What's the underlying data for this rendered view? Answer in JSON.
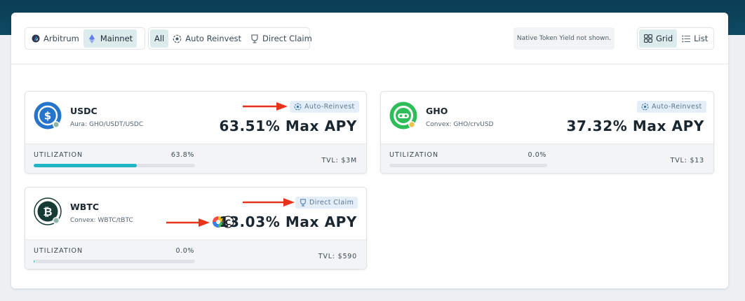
{
  "toolbar": {
    "networks": [
      {
        "label": "Arbitrum",
        "active": false
      },
      {
        "label": "Mainnet",
        "active": true
      }
    ],
    "filters": [
      {
        "label": "All",
        "active": true
      },
      {
        "label": "Auto Reinvest",
        "active": false
      },
      {
        "label": "Direct Claim",
        "active": false
      }
    ],
    "notice": "Native Token Yield not shown.",
    "views": [
      {
        "label": "Grid",
        "active": true
      },
      {
        "label": "List",
        "active": false
      }
    ]
  },
  "pools": [
    {
      "token": "USDC",
      "pool": "Aura: GHO/USDT/USDC",
      "badge": "Auto-Reinvest",
      "apy": "63.51% Max APY",
      "utilization_label": "UTILIZATION",
      "utilization": "63.8%",
      "utilization_fraction": 0.638,
      "tvl": "TVL: $3M"
    },
    {
      "token": "GHO",
      "pool": "Convex: GHO/crvUSD",
      "badge": "Auto-Reinvest",
      "apy": "37.32% Max APY",
      "utilization_label": "UTILIZATION",
      "utilization": "0.0%",
      "utilization_fraction": 0.0,
      "tvl": "TVL: $13"
    },
    {
      "token": "WBTC",
      "pool": "Convex: WBTC/tBTC",
      "badge": "Direct Claim",
      "apy": "13.03% Max APY",
      "utilization_label": "UTILIZATION",
      "utilization": "0.0%",
      "utilization_fraction": 0.005,
      "tvl": "TVL: $590"
    }
  ],
  "colors": {
    "header": "#0b3d55",
    "accent_teal": "#1fb5c4",
    "active_segment": "#dcecec",
    "badge_bg": "#e3eef8",
    "annotation_arrow": "#e8321c",
    "usdc_blue": "#2775ca",
    "gho_green": "#2ebd59",
    "wbtc_dark": "#163b35"
  },
  "icons": {
    "arbitrum": "arbitrum-logo-icon",
    "mainnet": "ethereum-logo-icon",
    "auto_reinvest": "reinvest-cycle-icon",
    "direct_claim": "claim-cup-icon",
    "grid": "grid-icon",
    "list": "list-icon"
  }
}
